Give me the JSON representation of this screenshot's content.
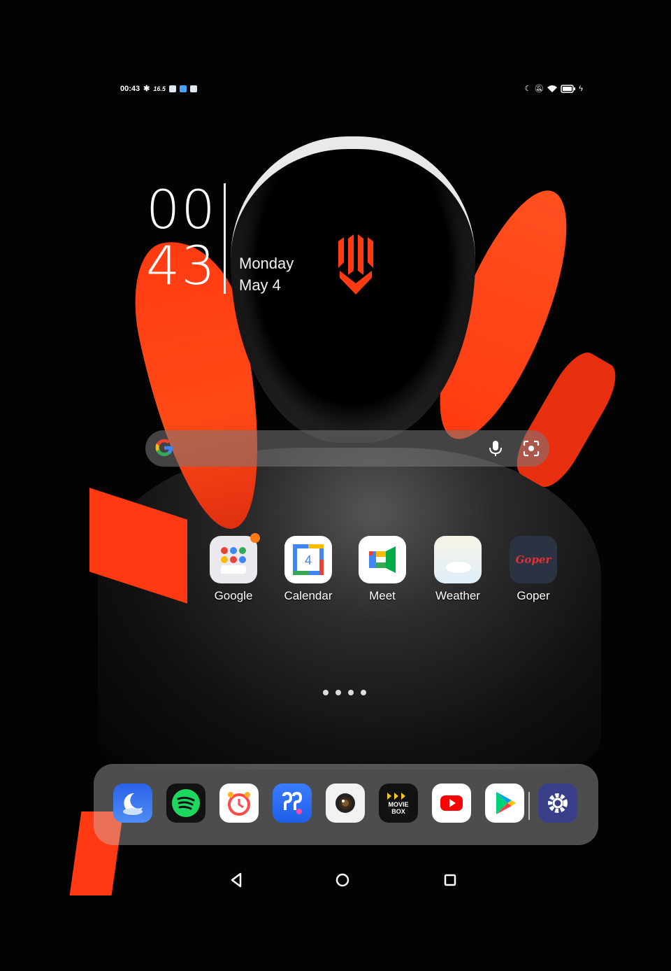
{
  "status_bar": {
    "time": "00:43",
    "left_extra": "16.5",
    "battery_level": "high"
  },
  "clock_widget": {
    "hours": "00",
    "minutes": "43",
    "day": "Monday",
    "date": "May 4"
  },
  "search_bar": {
    "icons": [
      "google-g-icon",
      "microphone-icon",
      "lens-icon"
    ]
  },
  "apps": [
    {
      "label": "Google",
      "icon": "google-folder-icon",
      "has_notification": true
    },
    {
      "label": "Calendar",
      "icon": "calendar-icon",
      "calendar_day": "4"
    },
    {
      "label": "Meet",
      "icon": "meet-icon"
    },
    {
      "label": "Weather",
      "icon": "weather-icon"
    },
    {
      "label": "Goper",
      "icon": "goper-icon",
      "icon_text": "Goper"
    }
  ],
  "page_indicator": {
    "pages": 4,
    "current": 1
  },
  "dock": [
    {
      "icon": "sleep-moon-icon"
    },
    {
      "icon": "spotify-icon"
    },
    {
      "icon": "alarm-clock-icon"
    },
    {
      "icon": "qq-icon"
    },
    {
      "icon": "camera-icon"
    },
    {
      "icon": "moviebox-icon",
      "icon_text": "MOVIE BOX"
    },
    {
      "icon": "youtube-icon"
    },
    {
      "icon": "play-store-icon"
    },
    {
      "icon": "settings-gear-icon"
    }
  ],
  "nav_bar": {
    "buttons": [
      "back-icon",
      "home-icon",
      "recents-icon"
    ]
  },
  "colors": {
    "accent_red": "#ff3a12",
    "dock_bg": "rgba(200,200,200,0.38)"
  }
}
